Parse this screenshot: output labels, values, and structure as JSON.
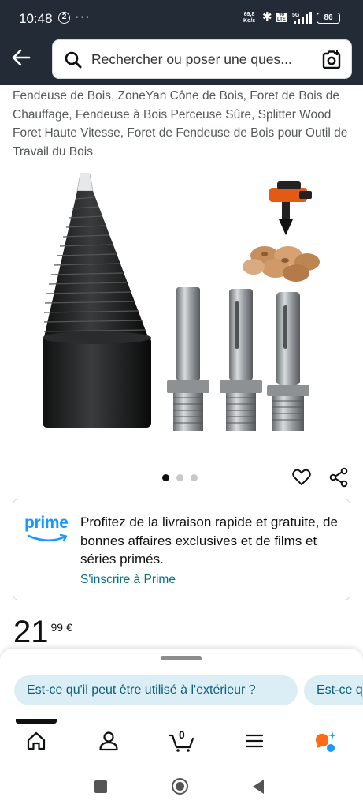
{
  "status_bar": {
    "time": "10:48",
    "notification_badge": "2",
    "more": "···",
    "net_speed_value": "69,8",
    "net_speed_unit": "Ko/s",
    "volte": "Vo LTE",
    "network": "5G",
    "battery": "86",
    "icons": [
      "bluetooth-icon",
      "signal-icon",
      "battery-icon"
    ]
  },
  "search": {
    "placeholder": "Rechercher ou poser une ques...",
    "icons": [
      "back-arrow-icon",
      "search-icon",
      "camera-scan-icon"
    ]
  },
  "product": {
    "title": "Fendeuse de Bois, ZoneYan Cône de Bois, Foret de Bois de Chauffage, Fendeuse à Bois Perceuse Sûre, Splitter Wood Foret Haute Vitesse, Foret de Fendeuse de Bois pour Outil de Travail du Bois",
    "image_count": 3,
    "active_image": 1,
    "price_whole": "21",
    "price_fraction": "99 €"
  },
  "prime": {
    "logo": "prime",
    "message": "Profitez de la livraison rapide et gratuite, de bonnes affaires exclusives et de films et séries primés.",
    "link": "S'inscrire à Prime"
  },
  "questions_sheet": {
    "chips": [
      "Est-ce qu'il peut être utilisé à l'extérieur ?",
      "Est-ce q"
    ]
  },
  "bottom_nav": {
    "items": [
      "home-icon",
      "account-icon",
      "cart-icon",
      "menu-icon",
      "rufus-ai-icon"
    ],
    "cart_count": "0",
    "active": "home-icon"
  },
  "colors": {
    "header_bg": "#222b36",
    "link": "#007185",
    "prime_blue": "#1a98ff",
    "chip_bg": "#dbeef5",
    "rufus_orange": "#ff6a14",
    "rufus_blue": "#1a98ff"
  }
}
